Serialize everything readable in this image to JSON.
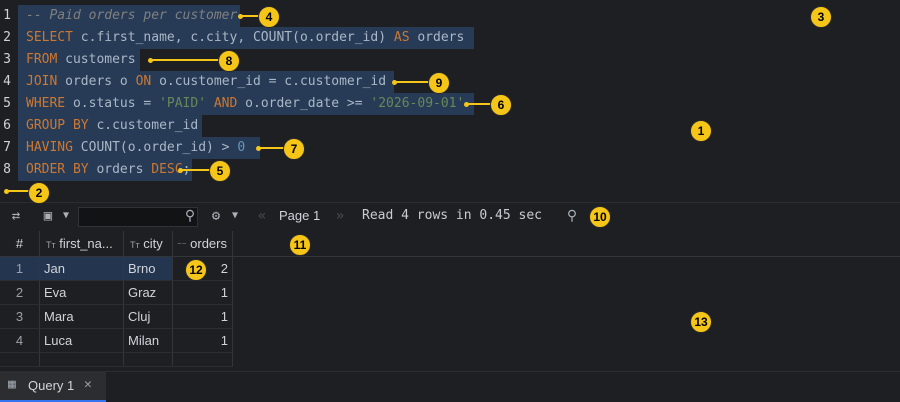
{
  "editor": {
    "lines": [
      {
        "n": "1",
        "parts": [
          {
            "t": "-- Paid orders per customer",
            "c": "cmt"
          }
        ]
      },
      {
        "n": "2",
        "parts": [
          {
            "t": "SELECT ",
            "c": "kw"
          },
          {
            "t": "c.first_name, c.city, COUNT(o.order_id) ",
            "c": "id"
          },
          {
            "t": "AS ",
            "c": "kw"
          },
          {
            "t": "orders",
            "c": "id"
          }
        ]
      },
      {
        "n": "3",
        "parts": [
          {
            "t": "FROM ",
            "c": "kw"
          },
          {
            "t": "customers",
            "c": "id"
          }
        ]
      },
      {
        "n": "4",
        "parts": [
          {
            "t": "JOIN ",
            "c": "kw"
          },
          {
            "t": "orders o ",
            "c": "id"
          },
          {
            "t": "ON ",
            "c": "kw"
          },
          {
            "t": "o.customer_id = c.customer_id",
            "c": "id"
          }
        ]
      },
      {
        "n": "5",
        "parts": [
          {
            "t": "WHERE ",
            "c": "kw"
          },
          {
            "t": "o.status = ",
            "c": "id"
          },
          {
            "t": "'PAID' ",
            "c": "str"
          },
          {
            "t": "AND ",
            "c": "kw"
          },
          {
            "t": "o.order_date >= ",
            "c": "id"
          },
          {
            "t": "'2026-09-01'",
            "c": "str"
          }
        ]
      },
      {
        "n": "6",
        "parts": [
          {
            "t": "GROUP BY ",
            "c": "kw"
          },
          {
            "t": "c.customer_id",
            "c": "id"
          }
        ]
      },
      {
        "n": "7",
        "parts": [
          {
            "t": "HAVING ",
            "c": "kw"
          },
          {
            "t": "COUNT(o.order_id) > ",
            "c": "id"
          },
          {
            "t": "0",
            "c": "num"
          }
        ]
      },
      {
        "n": "8",
        "parts": [
          {
            "t": "ORDER BY ",
            "c": "kw"
          },
          {
            "t": "orders ",
            "c": "id"
          },
          {
            "t": "DESC",
            "c": "kw"
          },
          {
            "t": ";",
            "c": "id"
          }
        ]
      }
    ]
  },
  "toolbar": {
    "page_label": "Page 1",
    "status_text": "Read 4 rows in 0.45 sec"
  },
  "grid": {
    "headers": {
      "rownum": "#",
      "first_name": "first_na...",
      "city": "city",
      "orders": "orders"
    },
    "type_hints": {
      "first_name": "Tт",
      "city": "Tт",
      "orders": "⁻⁻"
    },
    "rows": [
      {
        "n": "1",
        "first_name": "Jan",
        "city": "Brno",
        "orders": "2"
      },
      {
        "n": "2",
        "first_name": "Eva",
        "city": "Graz",
        "orders": "1"
      },
      {
        "n": "3",
        "first_name": "Mara",
        "city": "Cluj",
        "orders": "1"
      },
      {
        "n": "4",
        "first_name": "Luca",
        "city": "Milan",
        "orders": "1"
      }
    ]
  },
  "tabs": {
    "query_tab": "Query 1"
  },
  "badges": [
    "1",
    "2",
    "3",
    "4",
    "5",
    "6",
    "7",
    "8",
    "9",
    "10",
    "11",
    "12",
    "13"
  ],
  "icons": {
    "transpose": "transpose-icon",
    "save": "save-icon",
    "search": "search-icon",
    "settings": "gear-icon",
    "close": "close-icon",
    "grid": "grid-icon"
  }
}
